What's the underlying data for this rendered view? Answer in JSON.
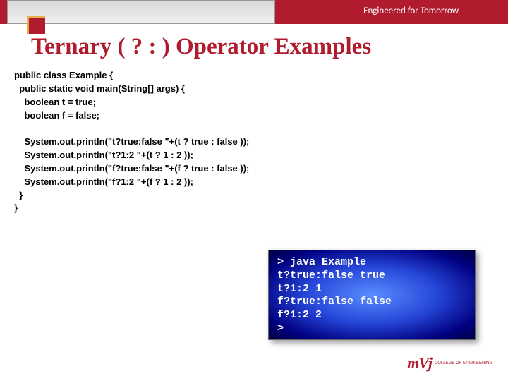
{
  "header": {
    "tagline": "Engineered for Tomorrow"
  },
  "title": "Ternary ( ? : ) Operator Examples",
  "code": "public class Example {\n  public static void main(String[] args) {\n    boolean t = true;\n    boolean f = false;\n\n    System.out.println(\"t?true:false \"+(t ? true : false ));\n    System.out.println(\"t?1:2 \"+(t ? 1 : 2 ));\n    System.out.println(\"f?true:false \"+(f ? true : false ));\n    System.out.println(\"f?1:2 \"+(f ? 1 : 2 ));\n  }\n}",
  "output": "> java Example\nt?true:false true\nt?1:2 1\nf?true:false false\nf?1:2 2\n>",
  "logo": {
    "brand": "mVj",
    "subtitle": "COLLEGE OF\nENGINEERING"
  }
}
